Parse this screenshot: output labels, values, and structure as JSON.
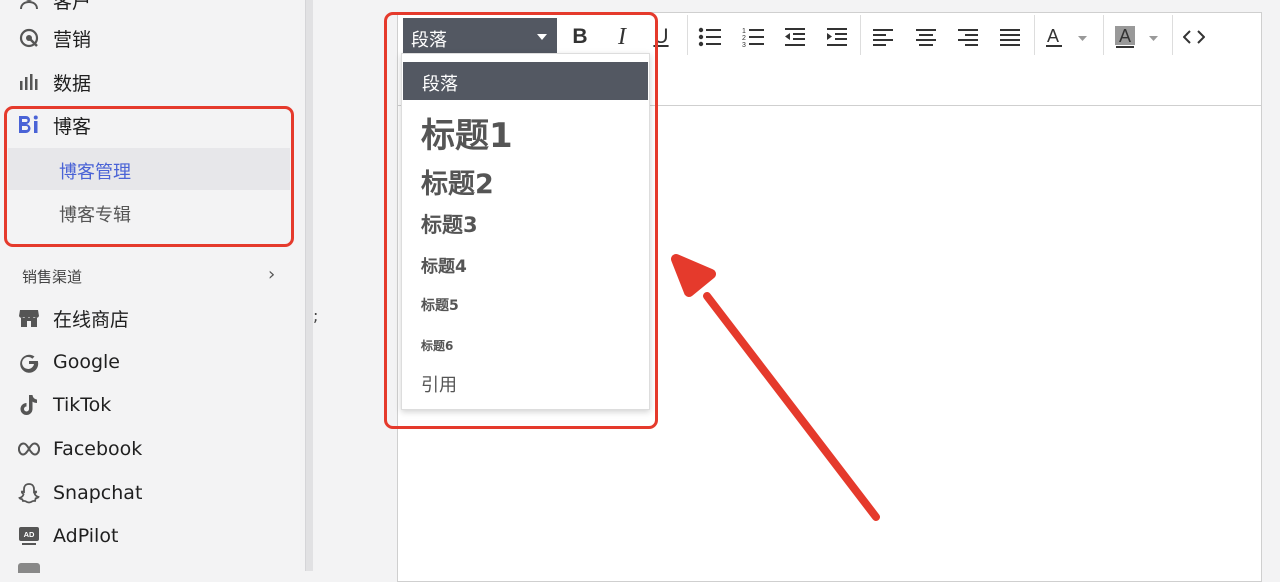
{
  "sidebar": {
    "top_item": {
      "label": "客户",
      "icon": "person-icon"
    },
    "items": [
      {
        "label": "营销",
        "icon": "marketing-icon"
      },
      {
        "label": "数据",
        "icon": "bar-chart-icon"
      },
      {
        "label": "博客",
        "icon": "blog-icon"
      }
    ],
    "blog_sub": [
      {
        "label": "博客管理",
        "active": true
      },
      {
        "label": "博客专辑",
        "active": false
      }
    ],
    "section": {
      "label": "销售渠道"
    },
    "channels": [
      {
        "label": "在线商店",
        "icon": "store-icon"
      },
      {
        "label": "Google",
        "icon": "google-icon"
      },
      {
        "label": "TikTok",
        "icon": "tiktok-icon"
      },
      {
        "label": "Facebook",
        "icon": "meta-icon"
      },
      {
        "label": "Snapchat",
        "icon": "snapchat-icon"
      },
      {
        "label": "AdPilot",
        "icon": "ad-icon"
      }
    ]
  },
  "editor": {
    "format_select": "段落",
    "toolbar_buttons": [
      "bold-icon",
      "italic-icon",
      "underline-icon",
      "bullet-list-icon",
      "numbered-list-icon",
      "outdent-icon",
      "indent-icon",
      "align-left-icon",
      "align-center-icon",
      "align-right-icon",
      "justify-icon",
      "font-color-icon",
      "highlight-icon",
      "code-view-icon"
    ]
  },
  "format_dropdown": {
    "options": [
      "段落",
      "标题1",
      "标题2",
      "标题3",
      "标题4",
      "标题5",
      "标题6",
      "引用"
    ],
    "selected": "段落"
  },
  "colors": {
    "accent": "#4a63d6",
    "annotation": "#e53a2c",
    "select_bg": "#535862"
  }
}
